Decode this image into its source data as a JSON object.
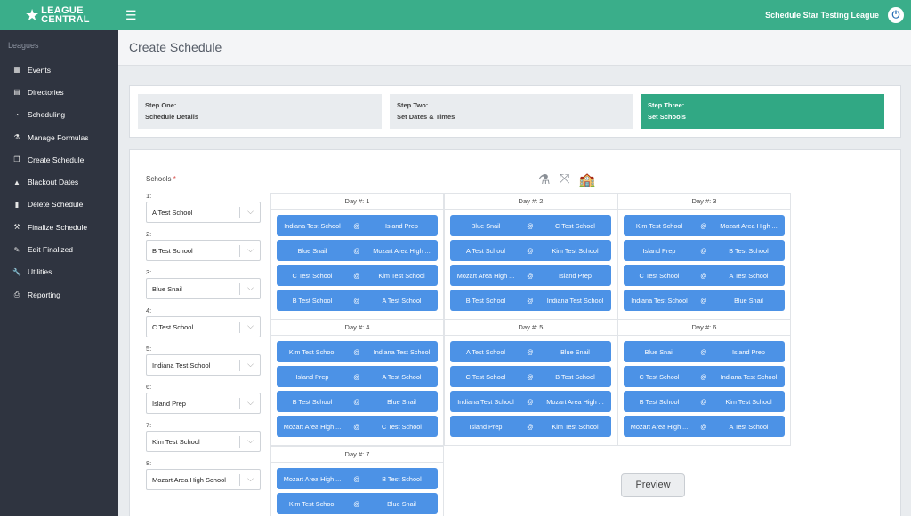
{
  "header": {
    "logo_line1": "LEAGUE",
    "logo_line2": "CENTRAL",
    "league_name": "Schedule Star Testing League"
  },
  "sidebar": {
    "heading": "Leagues",
    "items": [
      {
        "label": "Events",
        "icon": "calendar-icon",
        "glyph": "▦"
      },
      {
        "label": "Directories",
        "icon": "list-icon",
        "glyph": "▤"
      },
      {
        "label": "Scheduling",
        "icon": "clock-icon",
        "glyph": "◔"
      },
      {
        "label": "Manage Formulas",
        "icon": "flask-icon",
        "glyph": "⚗"
      },
      {
        "label": "Create Schedule",
        "icon": "copy-icon",
        "glyph": "❐"
      },
      {
        "label": "Blackout Dates",
        "icon": "warning-icon",
        "glyph": "▲"
      },
      {
        "label": "Delete Schedule",
        "icon": "trash-icon",
        "glyph": "▮"
      },
      {
        "label": "Finalize Schedule",
        "icon": "gavel-icon",
        "glyph": "⚒"
      },
      {
        "label": "Edit Finalized",
        "icon": "edit-icon",
        "glyph": "✎"
      },
      {
        "label": "Utilities",
        "icon": "wrench-icon",
        "glyph": "🔧"
      },
      {
        "label": "Reporting",
        "icon": "print-icon",
        "glyph": "⎙"
      }
    ]
  },
  "page": {
    "title": "Create Schedule"
  },
  "steps": [
    {
      "line1": "Step One:",
      "line2": "Schedule Details"
    },
    {
      "line1": "Step Two:",
      "line2": "Set Dates & Times"
    },
    {
      "line1": "Step Three:",
      "line2": "Set Schools"
    }
  ],
  "schools": {
    "label": "Schools",
    "required_mark": "*",
    "slots": [
      {
        "num": "1:",
        "value": "A Test School"
      },
      {
        "num": "2:",
        "value": "B Test School"
      },
      {
        "num": "3:",
        "value": "Blue Snail"
      },
      {
        "num": "4:",
        "value": "C Test School"
      },
      {
        "num": "5:",
        "value": "Indiana Test School"
      },
      {
        "num": "6:",
        "value": "Island Prep"
      },
      {
        "num": "7:",
        "value": "Kim Test School"
      },
      {
        "num": "8:",
        "value": "Mozart Area High School"
      }
    ]
  },
  "days": [
    {
      "title": "Day #: 1",
      "games": [
        {
          "home": "Indiana Test School",
          "away": "Island Prep"
        },
        {
          "home": "Blue Snail",
          "away": "Mozart Area High ..."
        },
        {
          "home": "C Test School",
          "away": "Kim Test School"
        },
        {
          "home": "B Test School",
          "away": "A Test School"
        }
      ]
    },
    {
      "title": "Day #: 2",
      "games": [
        {
          "home": "Blue Snail",
          "away": "C Test School"
        },
        {
          "home": "A Test School",
          "away": "Kim Test School"
        },
        {
          "home": "Mozart Area High ...",
          "away": "Island Prep"
        },
        {
          "home": "B Test School",
          "away": "Indiana Test School"
        }
      ]
    },
    {
      "title": "Day #: 3",
      "games": [
        {
          "home": "Kim Test School",
          "away": "Mozart Area High ..."
        },
        {
          "home": "Island Prep",
          "away": "B Test School"
        },
        {
          "home": "C Test School",
          "away": "A Test School"
        },
        {
          "home": "Indiana Test School",
          "away": "Blue Snail"
        }
      ]
    },
    {
      "title": "Day #: 4",
      "games": [
        {
          "home": "Kim Test School",
          "away": "Indiana Test School"
        },
        {
          "home": "Island Prep",
          "away": "A Test School"
        },
        {
          "home": "B Test School",
          "away": "Blue Snail"
        },
        {
          "home": "Mozart Area High ...",
          "away": "C Test School"
        }
      ]
    },
    {
      "title": "Day #: 5",
      "games": [
        {
          "home": "A Test School",
          "away": "Blue Snail"
        },
        {
          "home": "C Test School",
          "away": "B Test School"
        },
        {
          "home": "Indiana Test School",
          "away": "Mozart Area High ..."
        },
        {
          "home": "Island Prep",
          "away": "Kim Test School"
        }
      ]
    },
    {
      "title": "Day #: 6",
      "games": [
        {
          "home": "Blue Snail",
          "away": "Island Prep"
        },
        {
          "home": "C Test School",
          "away": "Indiana Test School"
        },
        {
          "home": "B Test School",
          "away": "Kim Test School"
        },
        {
          "home": "Mozart Area High ...",
          "away": "A Test School"
        }
      ]
    },
    {
      "title": "Day #: 7",
      "games": [
        {
          "home": "Mozart Area High ...",
          "away": "B Test School"
        },
        {
          "home": "Kim Test School",
          "away": "Blue Snail"
        }
      ]
    }
  ],
  "vs_symbol": "@",
  "tooltip": "Preview",
  "colors": {
    "brand": "#3aae8a",
    "game": "#4c92e6",
    "active_step": "#31a884",
    "sidebar": "#2f3440"
  }
}
